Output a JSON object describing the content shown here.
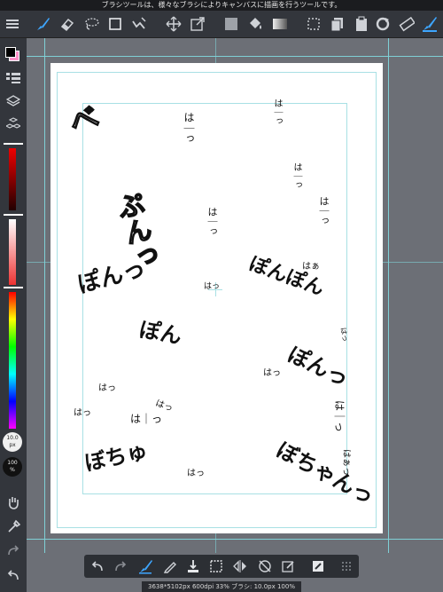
{
  "status_message": "ブラシツールは、様々なブラシによりキャンバスに描画を行うツールです。",
  "colors": {
    "main": "#000000",
    "sub": "#ff8fc7",
    "accent": "#3ea6ff",
    "hue_top": "#ff0000"
  },
  "toolbar_icons": [
    "menu-icon",
    "brush-icon",
    "eraser-icon",
    "lasso-icon",
    "rectangle-selection-icon",
    "auto-select-icon",
    "move-icon",
    "transform-icon",
    "fill-rect-icon",
    "bucket-icon",
    "gradient-icon",
    "layer-select-icon",
    "copy-icon",
    "paste-icon",
    "undo-circle-icon",
    "ruler-icon",
    "favorite-brush-icon"
  ],
  "left_panel": {
    "brush_size": "10.0",
    "brush_size_unit": "px",
    "opacity": "100",
    "opacity_unit": "%"
  },
  "canvas_text": {
    "be": "べ",
    "hah1": "は｜っ",
    "ha1": "は｜っ",
    "ha2": "は｜っ",
    "ha3": "は｜っ",
    "hah2": "は｜っ",
    "puni_outline": "ぷんっ",
    "haa": "はぁ",
    "pon1": "ぽんっ",
    "pon_center": "ぽんぽん",
    "ha_small": "はっ",
    "pon2": "ぽん",
    "ha_right": "はっ",
    "ha4": "はっ",
    "pon3": "ぽんっ",
    "ha5": "はっ",
    "ha6": "はっ",
    "ha7": "はっ",
    "hah3": "は｜っ",
    "hah4": "は｜っ",
    "bochu": "ぼちゅ",
    "ha8": "はっ",
    "bochan": "ぼちゃんっ",
    "haa2": "はぁっ"
  },
  "bottom_toolbar_icons": [
    "undo-icon",
    "redo-icon",
    "brush-tool-icon",
    "pen-icon",
    "import-icon",
    "fit-icon",
    "flip-icon",
    "no-rotate-icon",
    "edit-icon",
    "layer-icon",
    "grip-icon"
  ],
  "info_bar": "3638*5102px 600dpi 33% ブラシ: 10.0px 100%"
}
